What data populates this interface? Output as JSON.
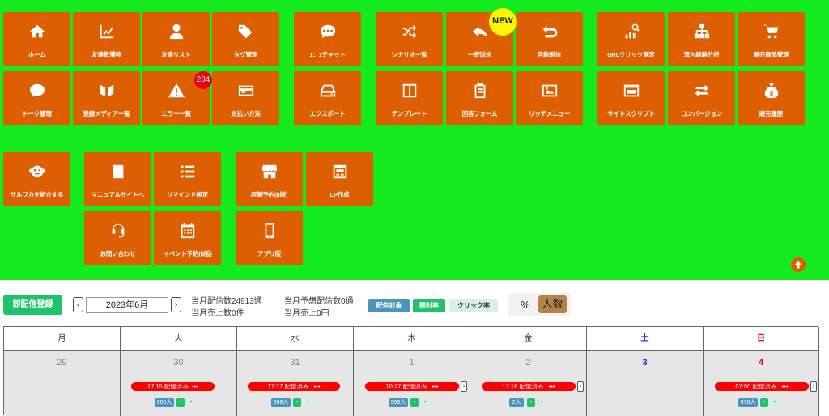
{
  "menu": {
    "tiles": [
      {
        "id": "home",
        "label": "ホーム",
        "icon": "home-icon"
      },
      {
        "id": "friend-trend",
        "label": "友達数遷移",
        "icon": "line-chart-icon"
      },
      {
        "id": "friend-list",
        "label": "友達リスト",
        "icon": "user-icon"
      },
      {
        "id": "tag",
        "label": "タグ管理",
        "icon": "tags-icon"
      },
      {
        "id": "chat",
        "label": "1：1チャット",
        "icon": "chat-bubble-icon"
      },
      {
        "id": "scenario",
        "label": "シナリオ一覧",
        "icon": "shuffle-icon"
      },
      {
        "id": "broadcast",
        "label": "一斉送信",
        "icon": "reply-icon"
      },
      {
        "id": "auto-reply",
        "label": "自動返信",
        "icon": "undo-icon"
      },
      {
        "id": "url-click",
        "label": "URLクリック測定",
        "icon": "chart-search-icon"
      },
      {
        "id": "route",
        "label": "流入経路分析",
        "icon": "sitemap-icon"
      },
      {
        "id": "product",
        "label": "販売商品管理",
        "icon": "cart-icon"
      },
      {
        "id": "talk",
        "label": "トーク管理",
        "icon": "comment-icon"
      },
      {
        "id": "media",
        "label": "登録メディア一覧",
        "icon": "media-icon"
      },
      {
        "id": "errors",
        "label": "エラー一覧",
        "icon": "warning-icon"
      },
      {
        "id": "payment",
        "label": "支払い方法",
        "icon": "credit-card-icon"
      },
      {
        "id": "export",
        "label": "エクスポート",
        "icon": "drive-icon"
      },
      {
        "id": "template",
        "label": "テンプレート",
        "icon": "columns-icon"
      },
      {
        "id": "form",
        "label": "回答フォーム",
        "icon": "form-icon"
      },
      {
        "id": "rich-menu",
        "label": "リッチメニュー",
        "icon": "image-icon"
      },
      {
        "id": "site-script",
        "label": "サイトスクリプト",
        "icon": "browser-icon"
      },
      {
        "id": "conversion",
        "label": "コンバージョン",
        "icon": "exchange-icon"
      },
      {
        "id": "sales",
        "label": "販売履歴",
        "icon": "money-bag-icon"
      },
      {
        "id": "referral",
        "label": "サルワカを紹介する",
        "icon": "monkey-icon"
      },
      {
        "id": "manual",
        "label": "マニュアルサイトへ",
        "icon": "book-icon"
      },
      {
        "id": "remind",
        "label": "リマインド設定",
        "icon": "list-icon"
      },
      {
        "id": "reservation",
        "label": "店舗予約(β版)",
        "icon": "store-icon"
      },
      {
        "id": "lp",
        "label": "LP作成",
        "icon": "layout-icon"
      },
      {
        "id": "contact",
        "label": "お問い合わせ",
        "icon": "headset-icon"
      },
      {
        "id": "event",
        "label": "イベント予約(β版)",
        "icon": "calendar-icon"
      },
      {
        "id": "app",
        "label": "アプリ版",
        "icon": "mobile-icon"
      }
    ],
    "new_badge": "NEW",
    "error_badge": "284"
  },
  "toolbar": {
    "register_label": "即配信登録",
    "prev": "‹",
    "next": "›",
    "month": "2023年6月",
    "stats": {
      "monthly_sent": "当月配信数24913通",
      "monthly_sales_count": "当月売上数0件",
      "expected_sent": "当月予想配信数0通",
      "monthly_sales": "当月売上0円"
    },
    "filters": [
      "配信対象",
      "開封率",
      "クリック率"
    ],
    "percent": "%",
    "people": "人数"
  },
  "calendar": {
    "weekdays": [
      "月",
      "火",
      "水",
      "木",
      "金",
      "土",
      "日"
    ],
    "days": [
      {
        "date": "29",
        "events": []
      },
      {
        "date": "30",
        "event": "17:15 配信済み",
        "count": "960人"
      },
      {
        "date": "31",
        "event": "17:17 配信済み",
        "count": "958人"
      },
      {
        "date": "1",
        "event": "10:27 配信済み",
        "count": "963人"
      },
      {
        "date": "2",
        "event": "17:16 配信済み",
        "count": "2人"
      },
      {
        "date": "3",
        "events": []
      },
      {
        "date": "4",
        "event": "07:00 配信済み",
        "count": "976人"
      }
    ],
    "ellipsis": "•••",
    "more_arrow": "›",
    "dash": "-"
  },
  "colors": {
    "panel_bg": "#13ea1f",
    "tile_bg": "#de5e02",
    "saturday": "#4d1ce0",
    "sunday": "#e60012"
  }
}
